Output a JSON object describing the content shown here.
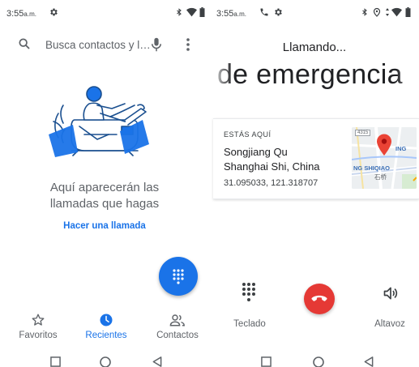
{
  "colors": {
    "accent": "#1a73e8",
    "end_call": "#e53935",
    "map_pin": "#ea4335"
  },
  "left": {
    "status": {
      "time": "3:55",
      "ampm": "a.m.",
      "icons": [
        "gear-icon",
        "bluetooth-icon",
        "wifi-icon",
        "battery-icon"
      ]
    },
    "search": {
      "placeholder": "Busca contactos y l…"
    },
    "empty_state": {
      "line1": "Aquí aparecerán las",
      "line2": "llamadas que hagas",
      "action": "Hacer una llamada"
    },
    "nav": {
      "favorites": "Favoritos",
      "recents": "Recientes",
      "contacts": "Contactos",
      "active": "recents"
    }
  },
  "right": {
    "status": {
      "time": "3:55",
      "ampm": "a.m.",
      "icons": [
        "phone-icon",
        "gear-icon",
        "bluetooth-icon",
        "location-icon",
        "data-icon",
        "wifi-icon",
        "battery-icon"
      ]
    },
    "calling_label": "Llamando...",
    "number": "a de emergencia",
    "location": {
      "label": "ESTÁS AQUÍ",
      "line1": "Songjiang Qu",
      "line2": "Shanghai Shi, China",
      "coords": "31.095033, 121.318707",
      "map_chip": "4315",
      "map_text_top": "ING",
      "map_text_mid": "NG SHIQIAO",
      "map_text_small": "石桥"
    },
    "controls": {
      "keypad": "Teclado",
      "speaker": "Altavoz"
    }
  }
}
